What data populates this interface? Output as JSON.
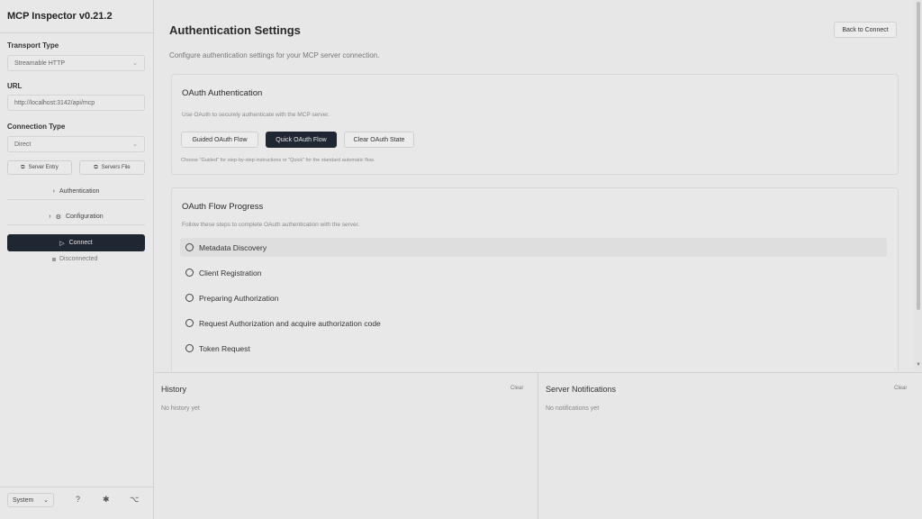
{
  "app": {
    "title": "MCP Inspector v0.21.2"
  },
  "sidebar": {
    "transport_label": "Transport Type",
    "transport_value": "Streamable HTTP",
    "url_label": "URL",
    "url_value": "http://localhost:3142/api/mcp",
    "connection_label": "Connection Type",
    "connection_value": "Direct",
    "server_entry": "Server Entry",
    "servers_file": "Servers File",
    "auth_row": "Authentication",
    "config_row": "Configuration",
    "connect_label": "Connect",
    "status_text": "Disconnected",
    "theme_value": "System"
  },
  "main": {
    "title": "Authentication Settings",
    "subtitle": "Configure authentication settings for your MCP server connection.",
    "back_label": "Back to Connect",
    "oauth": {
      "title": "OAuth Authentication",
      "description": "Use OAuth to securely authenticate with the MCP server.",
      "guided_label": "Guided OAuth Flow",
      "quick_label": "Quick OAuth Flow",
      "clear_label": "Clear OAuth State",
      "note": "Choose \"Guided\" for step-by-step instructions or \"Quick\" for the standard automatic flow."
    },
    "progress": {
      "title": "OAuth Flow Progress",
      "description": "Follow these steps to complete OAuth authentication with the server.",
      "steps": [
        "Metadata Discovery",
        "Client Registration",
        "Preparing Authorization",
        "Request Authorization and acquire authorization code",
        "Token Request"
      ]
    }
  },
  "history": {
    "title": "History",
    "empty": "No history yet",
    "clear": "Clear"
  },
  "notifications": {
    "title": "Server Notifications",
    "empty": "No notifications yet",
    "clear": "Clear"
  }
}
